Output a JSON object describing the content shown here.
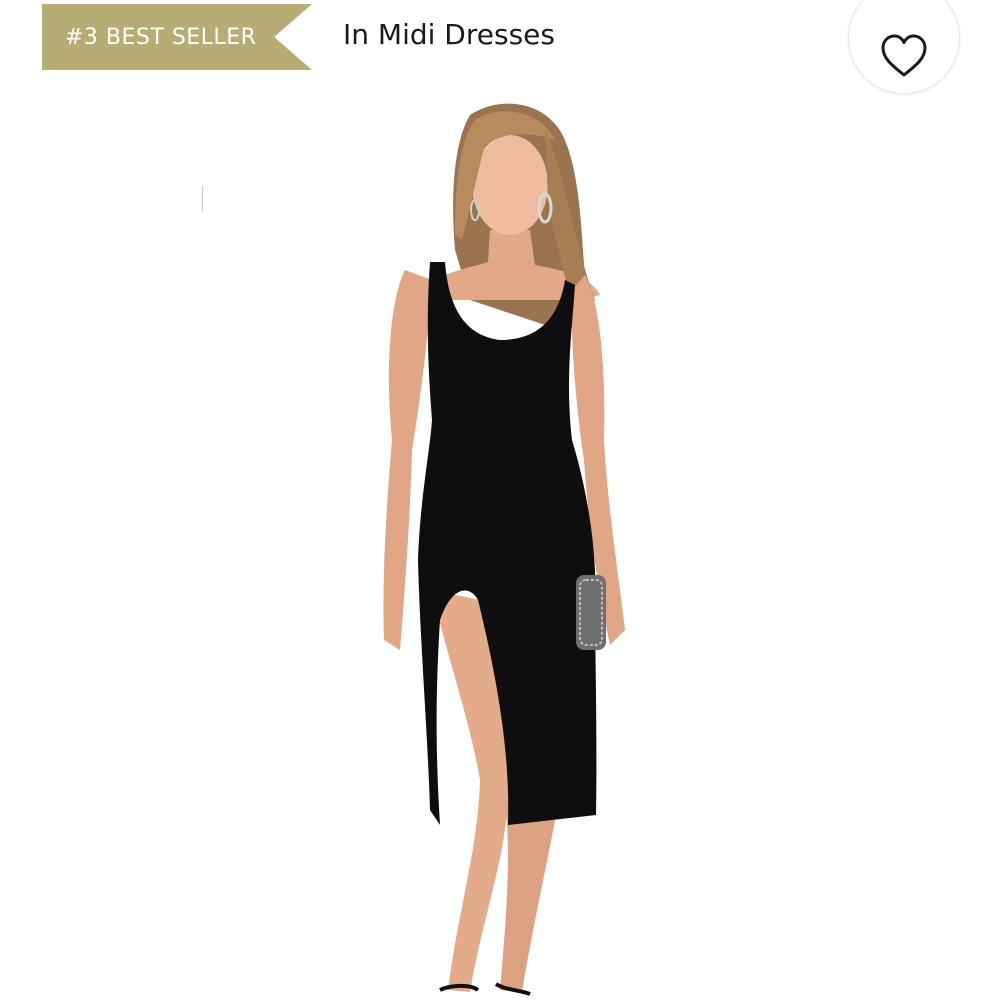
{
  "badge": {
    "label": "#3 BEST SELLER",
    "color": "#b7ad74"
  },
  "category": {
    "label": "In Midi Dresses"
  },
  "favorite": {
    "icon": "heart-icon"
  },
  "product": {
    "image": "product-model-photo"
  }
}
